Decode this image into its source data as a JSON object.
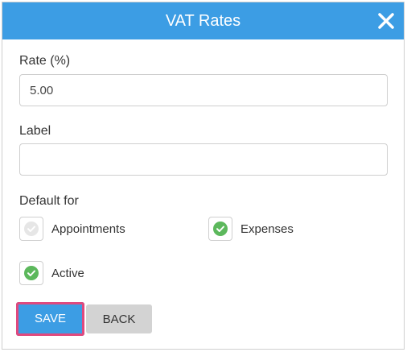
{
  "dialog": {
    "title": "VAT Rates",
    "close_icon": "close-icon"
  },
  "rate": {
    "label": "Rate (%)",
    "value": "5.00"
  },
  "label_field": {
    "label": "Label",
    "value": ""
  },
  "default_for": {
    "label": "Default for",
    "appointments": {
      "label": "Appointments",
      "checked": false
    },
    "expenses": {
      "label": "Expenses",
      "checked": true
    }
  },
  "active": {
    "label": "Active",
    "checked": true
  },
  "buttons": {
    "save": "SAVE",
    "back": "BACK"
  },
  "colors": {
    "header": "#3c9de4",
    "check_on": "#5cb85c",
    "check_off": "#e6e6e6",
    "save_highlight": "#e0497e"
  }
}
